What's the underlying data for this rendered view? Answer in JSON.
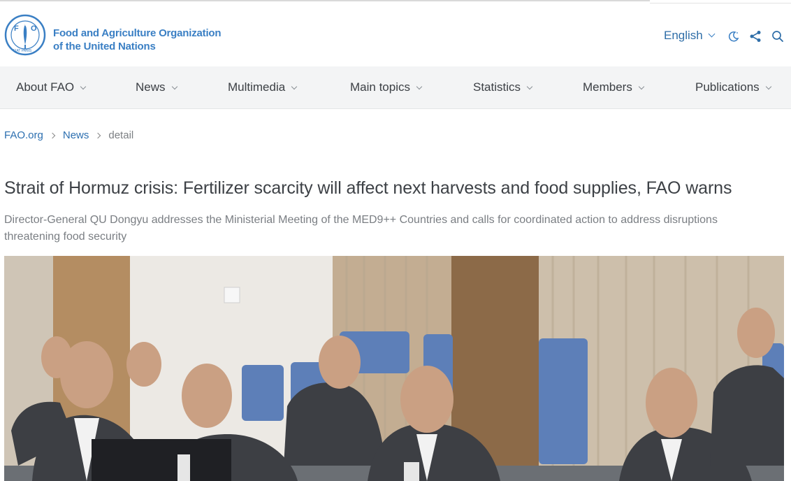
{
  "brand": {
    "logo_letters": "FAO",
    "logo_motto": "FIAT PANIS",
    "org_line1": "Food and Agriculture Organization",
    "org_line2": "of the United Nations"
  },
  "tools": {
    "language": "English",
    "icons": [
      "dark-mode-icon",
      "share-icon",
      "search-icon"
    ]
  },
  "nav": {
    "items": [
      {
        "label": "About FAO"
      },
      {
        "label": "News"
      },
      {
        "label": "Multimedia"
      },
      {
        "label": "Main topics"
      },
      {
        "label": "Statistics"
      },
      {
        "label": "Members"
      },
      {
        "label": "Publications"
      }
    ]
  },
  "breadcrumb": {
    "home": "FAO.org",
    "section": "News",
    "current": "detail"
  },
  "article": {
    "title": "Strait of Hormuz crisis: Fertilizer scarcity will affect next harvests and food supplies, FAO warns",
    "subtitle": "Director-General QU Dongyu addresses the Ministerial Meeting of the MED9++ Countries and calls for coordinated action to address disruptions threatening food security"
  },
  "colors": {
    "brand_blue": "#3a7fc4",
    "link_blue": "#2c6fb0",
    "nav_bg": "#f3f4f5"
  }
}
